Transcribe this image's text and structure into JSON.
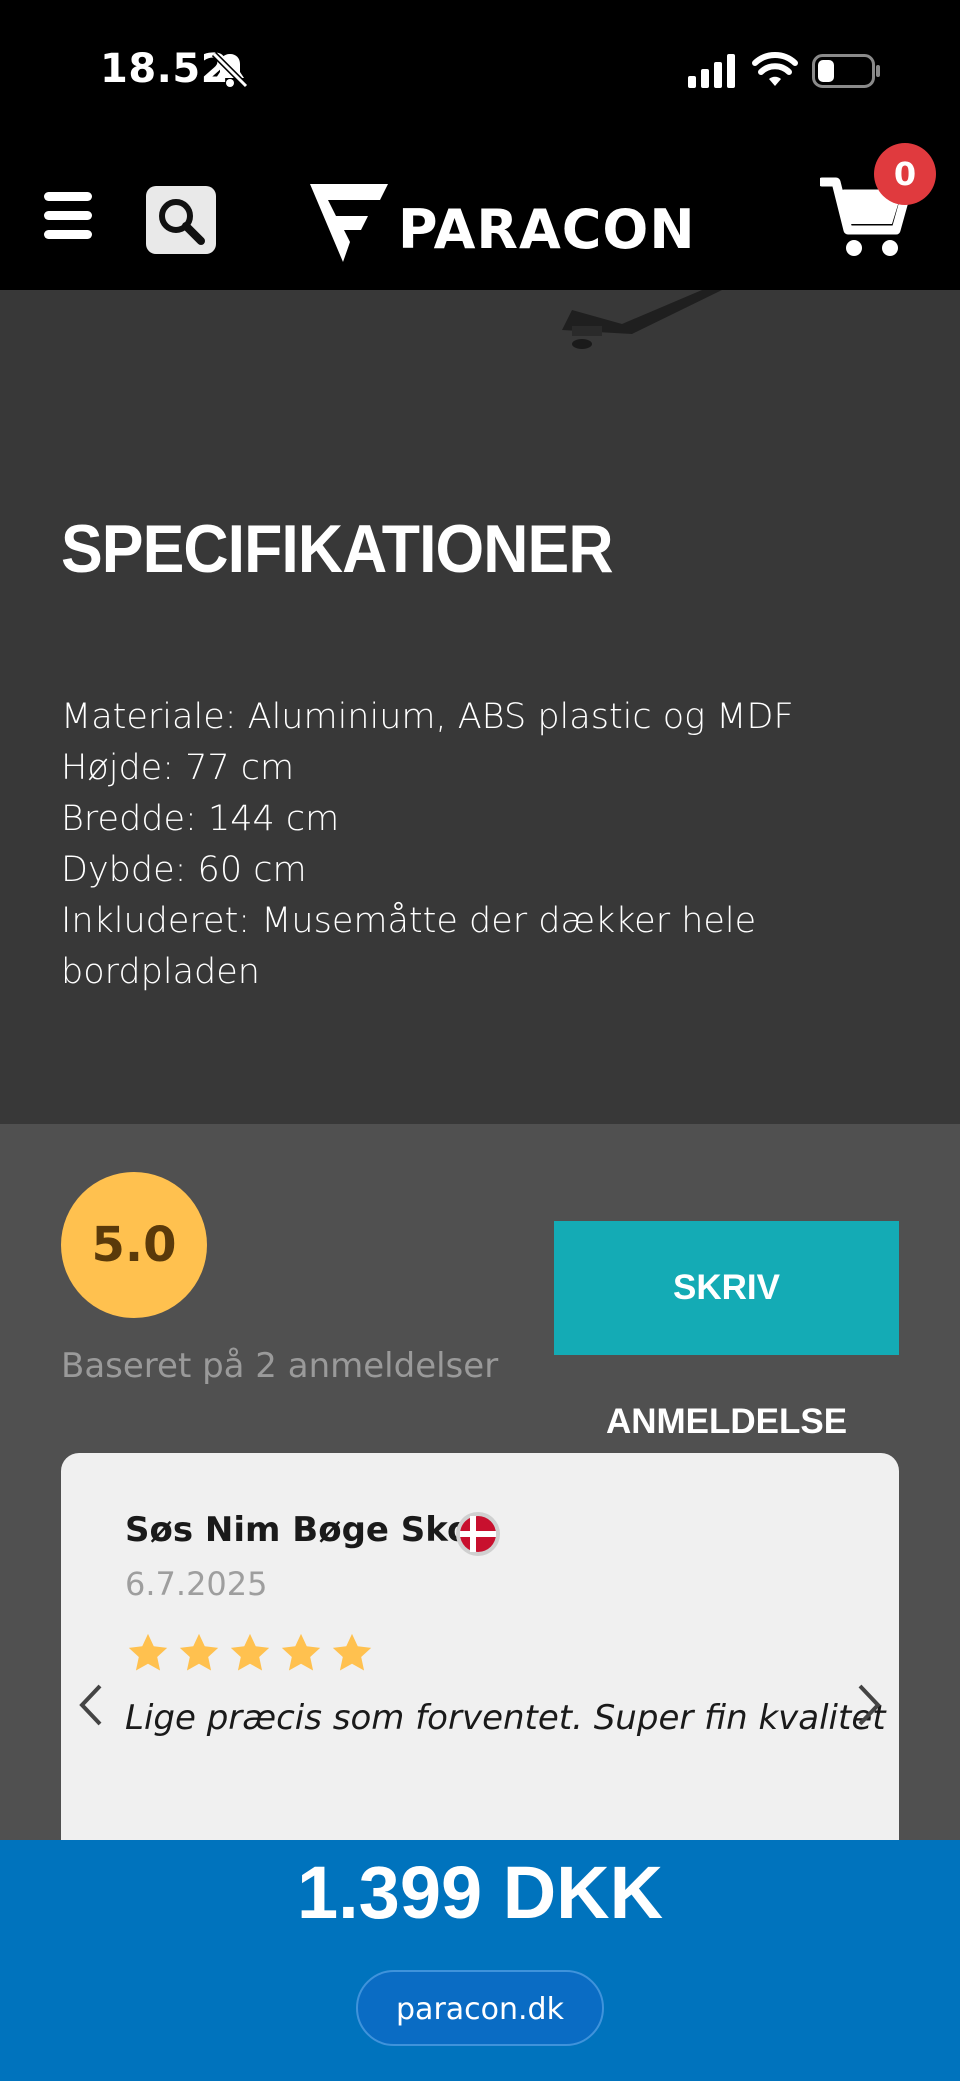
{
  "status_bar": {
    "time": "18.52",
    "icons": [
      "bell-muted-icon",
      "signal-icon",
      "wifi-icon",
      "battery-icon"
    ]
  },
  "header": {
    "brand": "PARACON",
    "cart_count": "0",
    "icons": [
      "menu-icon",
      "search-icon",
      "cart-icon"
    ]
  },
  "specs": {
    "title": "SPECIFIKATIONER",
    "lines": [
      "Materiale: Aluminium, ABS plastic og MDF",
      "Højde: 77 cm",
      "Bredde: 144 cm",
      "Dybde: 60 cm",
      "Inkluderet: Musemåtte der dækker hele",
      "bordpladen"
    ]
  },
  "reviews": {
    "rating": "5.0",
    "based_on": "Baseret på 2 anmeldelser",
    "write_button": "SKRIV ANMELDELSE",
    "items": [
      {
        "name": "Søs Nim Bøge Skov",
        "date": "6.7.2025",
        "stars": 5,
        "text": "Lige præcis som forventet. Super fin kvalitet"
      }
    ]
  },
  "footer": {
    "price": "1.399 DKK",
    "url": "paracon.dk"
  },
  "colors": {
    "header_bg": "#000000",
    "specs_bg": "#383838",
    "reviews_bg": "#505050",
    "rating_circle": "#ffc14f",
    "write_button_bg": "#14abb5",
    "price_bar": "#0073bd",
    "cart_badge": "#e03a3e",
    "star": "#ffc14f"
  }
}
